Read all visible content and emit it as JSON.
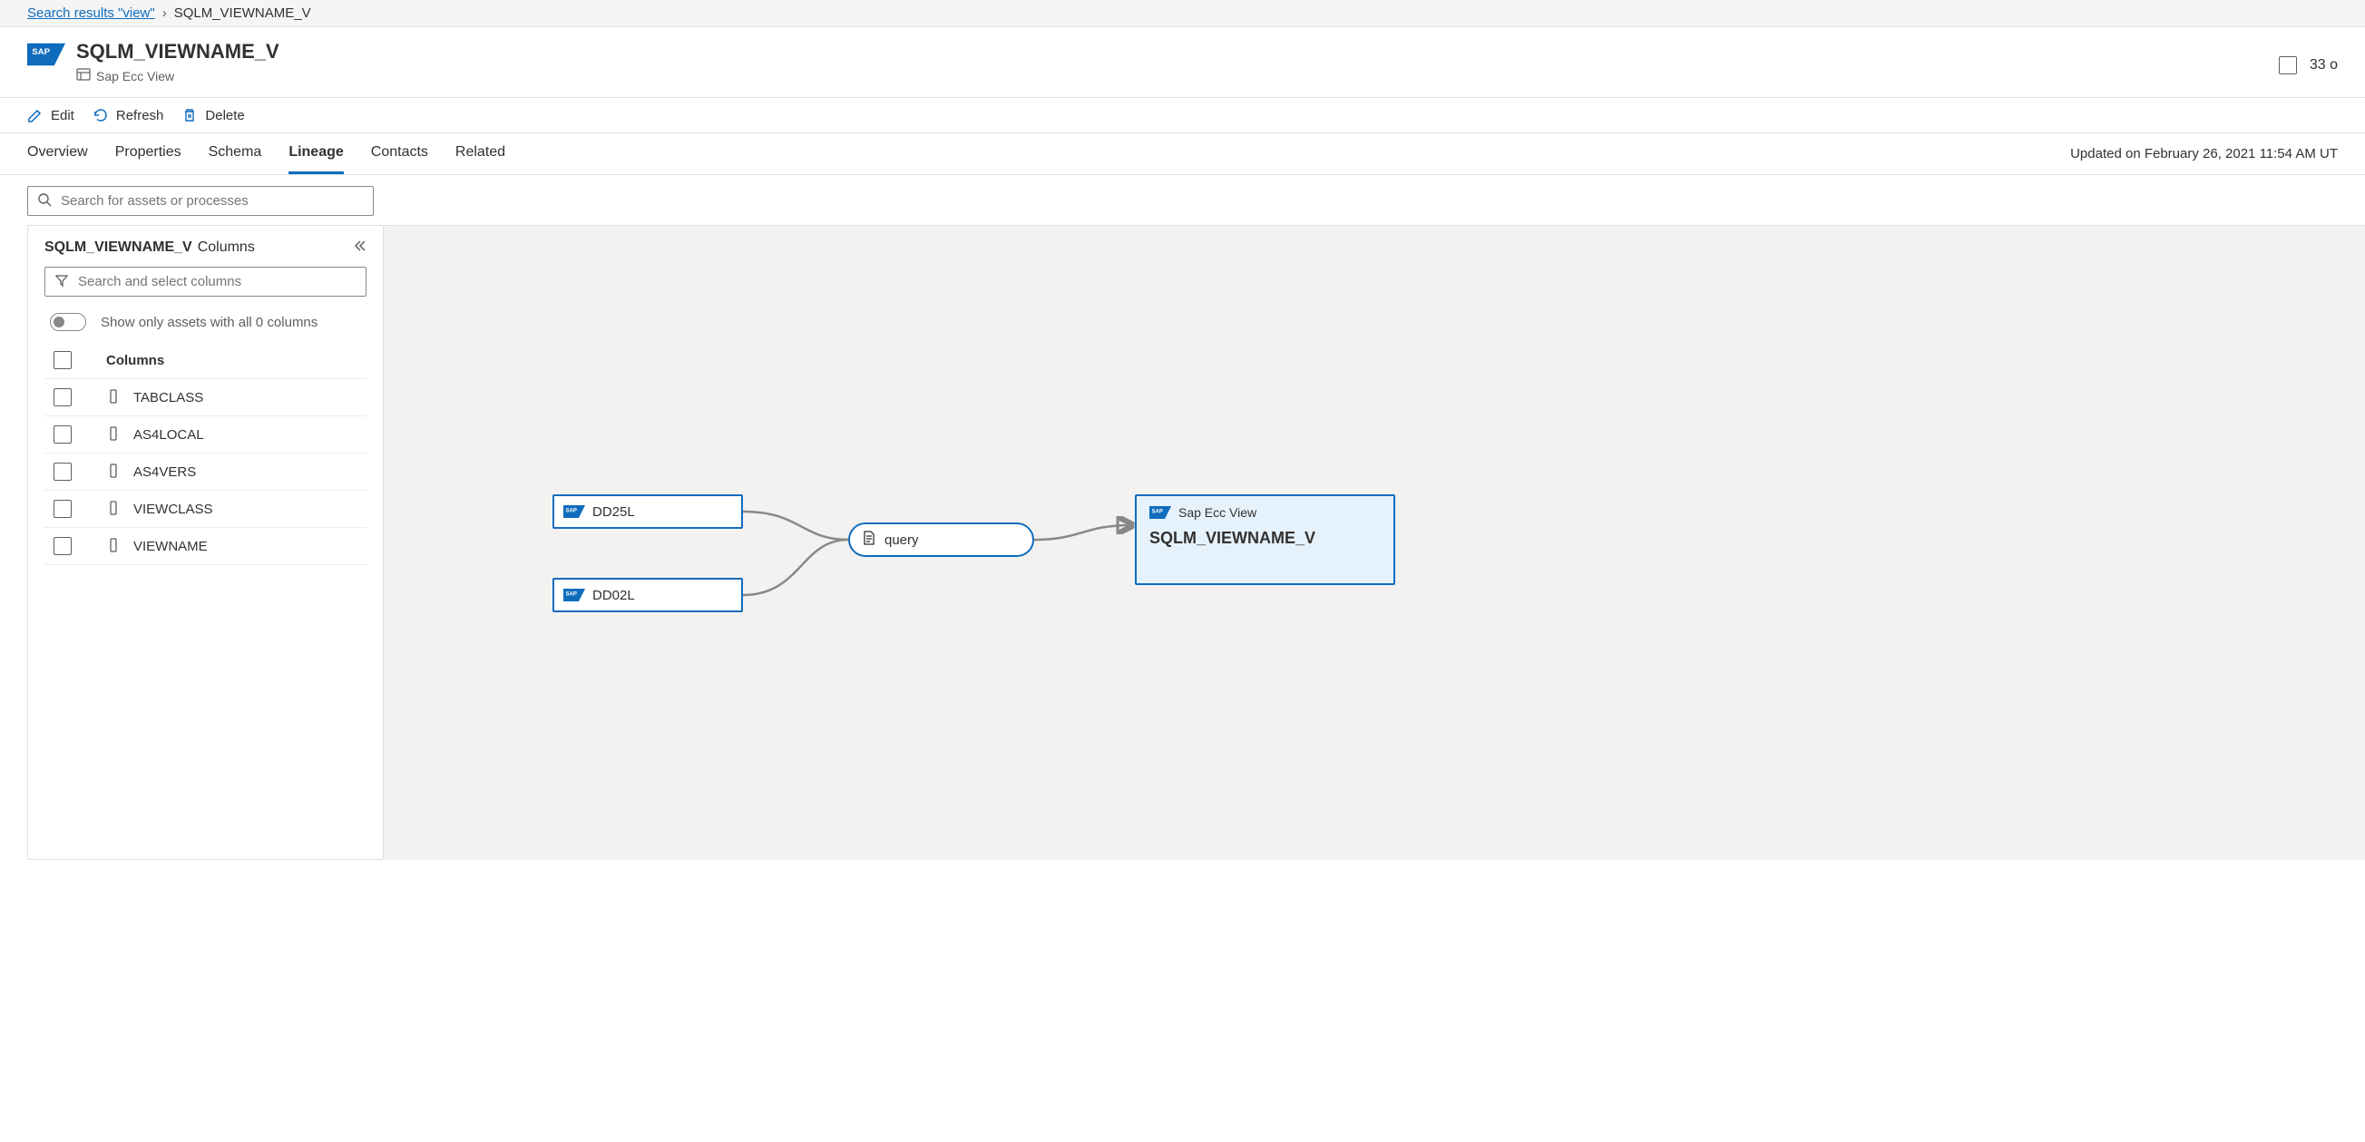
{
  "breadcrumb": {
    "link": "Search results \"view\"",
    "current": "SQLM_VIEWNAME_V"
  },
  "header": {
    "title": "SQLM_VIEWNAME_V",
    "subtitle": "Sap Ecc View",
    "count": "33 o"
  },
  "toolbar": {
    "edit": "Edit",
    "refresh": "Refresh",
    "delete": "Delete"
  },
  "tabs": [
    {
      "label": "Overview",
      "active": false
    },
    {
      "label": "Properties",
      "active": false
    },
    {
      "label": "Schema",
      "active": false
    },
    {
      "label": "Lineage",
      "active": true
    },
    {
      "label": "Contacts",
      "active": false
    },
    {
      "label": "Related",
      "active": false
    }
  ],
  "updated": "Updated on February 26, 2021 11:54 AM UT",
  "search": {
    "placeholder": "Search for assets or processes"
  },
  "panel": {
    "title1": "SQLM_VIEWNAME_V",
    "title2": "Columns",
    "filter_placeholder": "Search and select columns",
    "toggle_label": "Show only assets with all 0 columns",
    "columns_header": "Columns",
    "columns": [
      {
        "name": "TABCLASS"
      },
      {
        "name": "AS4LOCAL"
      },
      {
        "name": "AS4VERS"
      },
      {
        "name": "VIEWCLASS"
      },
      {
        "name": "VIEWNAME"
      }
    ]
  },
  "lineage": {
    "sources": [
      {
        "name": "DD25L"
      },
      {
        "name": "DD02L"
      }
    ],
    "process": {
      "name": "query"
    },
    "target": {
      "subtitle": "Sap Ecc View",
      "title": "SQLM_VIEWNAME_V"
    }
  }
}
